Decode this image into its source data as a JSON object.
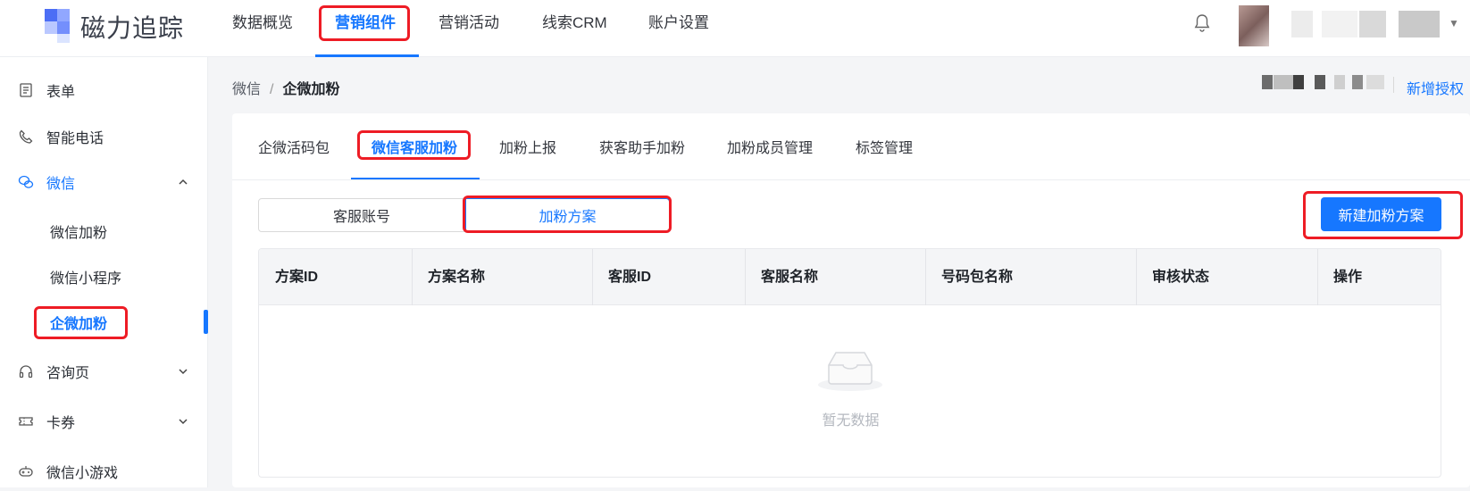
{
  "app": {
    "name": "磁力追踪"
  },
  "topnav": {
    "items": [
      {
        "label": "数据概览"
      },
      {
        "label": "营销组件"
      },
      {
        "label": "营销活动"
      },
      {
        "label": "线索CRM"
      },
      {
        "label": "账户设置"
      }
    ],
    "active_index": 1
  },
  "sidebar": {
    "items": [
      {
        "label": "表单",
        "icon": "form-icon"
      },
      {
        "label": "智能电话",
        "icon": "phone-icon"
      },
      {
        "label": "微信",
        "icon": "wechat-icon",
        "expanded": true,
        "children": [
          {
            "label": "微信加粉"
          },
          {
            "label": "微信小程序"
          },
          {
            "label": "企微加粉",
            "active": true
          }
        ]
      },
      {
        "label": "咨询页",
        "icon": "headset-icon"
      },
      {
        "label": "卡券",
        "icon": "ticket-icon"
      },
      {
        "label": "微信小游戏",
        "icon": "gamepad-icon"
      }
    ]
  },
  "breadcrumb": {
    "parent": "微信",
    "current": "企微加粉"
  },
  "header_right": {
    "new_auth_label": "新增授权"
  },
  "tabs": [
    {
      "label": "企微活码包"
    },
    {
      "label": "微信客服加粉",
      "active": true
    },
    {
      "label": "加粉上报"
    },
    {
      "label": "获客助手加粉"
    },
    {
      "label": "加粉成员管理"
    },
    {
      "label": "标签管理"
    }
  ],
  "segment": {
    "left": "客服账号",
    "right": "加粉方案",
    "selected": "right"
  },
  "actions": {
    "create_label": "新建加粉方案"
  },
  "table": {
    "columns": [
      "方案ID",
      "方案名称",
      "客服ID",
      "客服名称",
      "号码包名称",
      "审核状态",
      "操作"
    ],
    "rows": [],
    "empty_text": "暂无数据"
  },
  "colors": {
    "accent": "#1677ff",
    "highlight": "#ee1c25"
  }
}
